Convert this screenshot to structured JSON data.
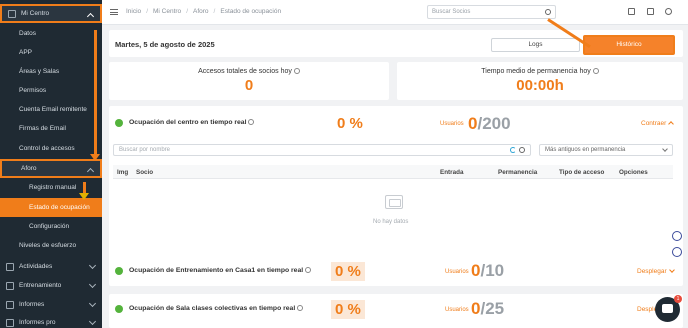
{
  "sidebar": {
    "items": [
      {
        "label": "Mi Centro"
      },
      {
        "label": "Datos"
      },
      {
        "label": "APP"
      },
      {
        "label": "Áreas y Salas"
      },
      {
        "label": "Permisos"
      },
      {
        "label": "Cuenta Email remitente"
      },
      {
        "label": "Firmas de Email"
      },
      {
        "label": "Control de accesos"
      },
      {
        "label": "Aforo"
      },
      {
        "label": "Registro manual"
      },
      {
        "label": "Estado de ocupación"
      },
      {
        "label": "Configuración"
      },
      {
        "label": "Niveles de esfuerzo"
      },
      {
        "label": "Actividades"
      },
      {
        "label": "Entrenamiento"
      },
      {
        "label": "Informes"
      },
      {
        "label": "Informes pro"
      }
    ]
  },
  "topbar": {
    "breadcrumbs": [
      "Inicio",
      "Mi Centro",
      "Aforo",
      "Estado de ocupación"
    ],
    "search_placeholder": "Buscar Socios"
  },
  "header": {
    "date": "Martes, 5 de agosto de 2025",
    "logs_label": "Logs",
    "historico_label": "Histórico"
  },
  "stats": {
    "total_label": "Accesos totales de socios hoy",
    "total_value": "0",
    "avg_label": "Tiempo medio de permanencia hoy",
    "avg_value": "00:00h"
  },
  "center_panel": {
    "title": "Ocupación del centro en tiempo real",
    "percent": "0 %",
    "usuarios_label": "Usuarios",
    "current": "0",
    "capacity": "/200",
    "toggle_label": "Contraer",
    "search_placeholder": "Buscar por nombre",
    "sort_value": "Más antiguos en permanencia",
    "columns": [
      "Img",
      "Socio",
      "Entrada",
      "Permanencia",
      "Tipo de acceso",
      "Opciones"
    ],
    "empty_text": "No hay datos"
  },
  "panels": [
    {
      "title": "Ocupación de Entrenamiento en Casa1 en tiempo real",
      "percent": "0 %",
      "usuarios_label": "Usuarios",
      "current": "0",
      "capacity": "/10",
      "toggle_label": "Desplegar"
    },
    {
      "title": "Ocupación de Sala clases colectivas en tiempo real",
      "percent": "0 %",
      "usuarios_label": "Usuarios",
      "current": "0",
      "capacity": "/25",
      "toggle_label": "Desplegar"
    }
  ],
  "chat": {
    "badge": "1"
  }
}
